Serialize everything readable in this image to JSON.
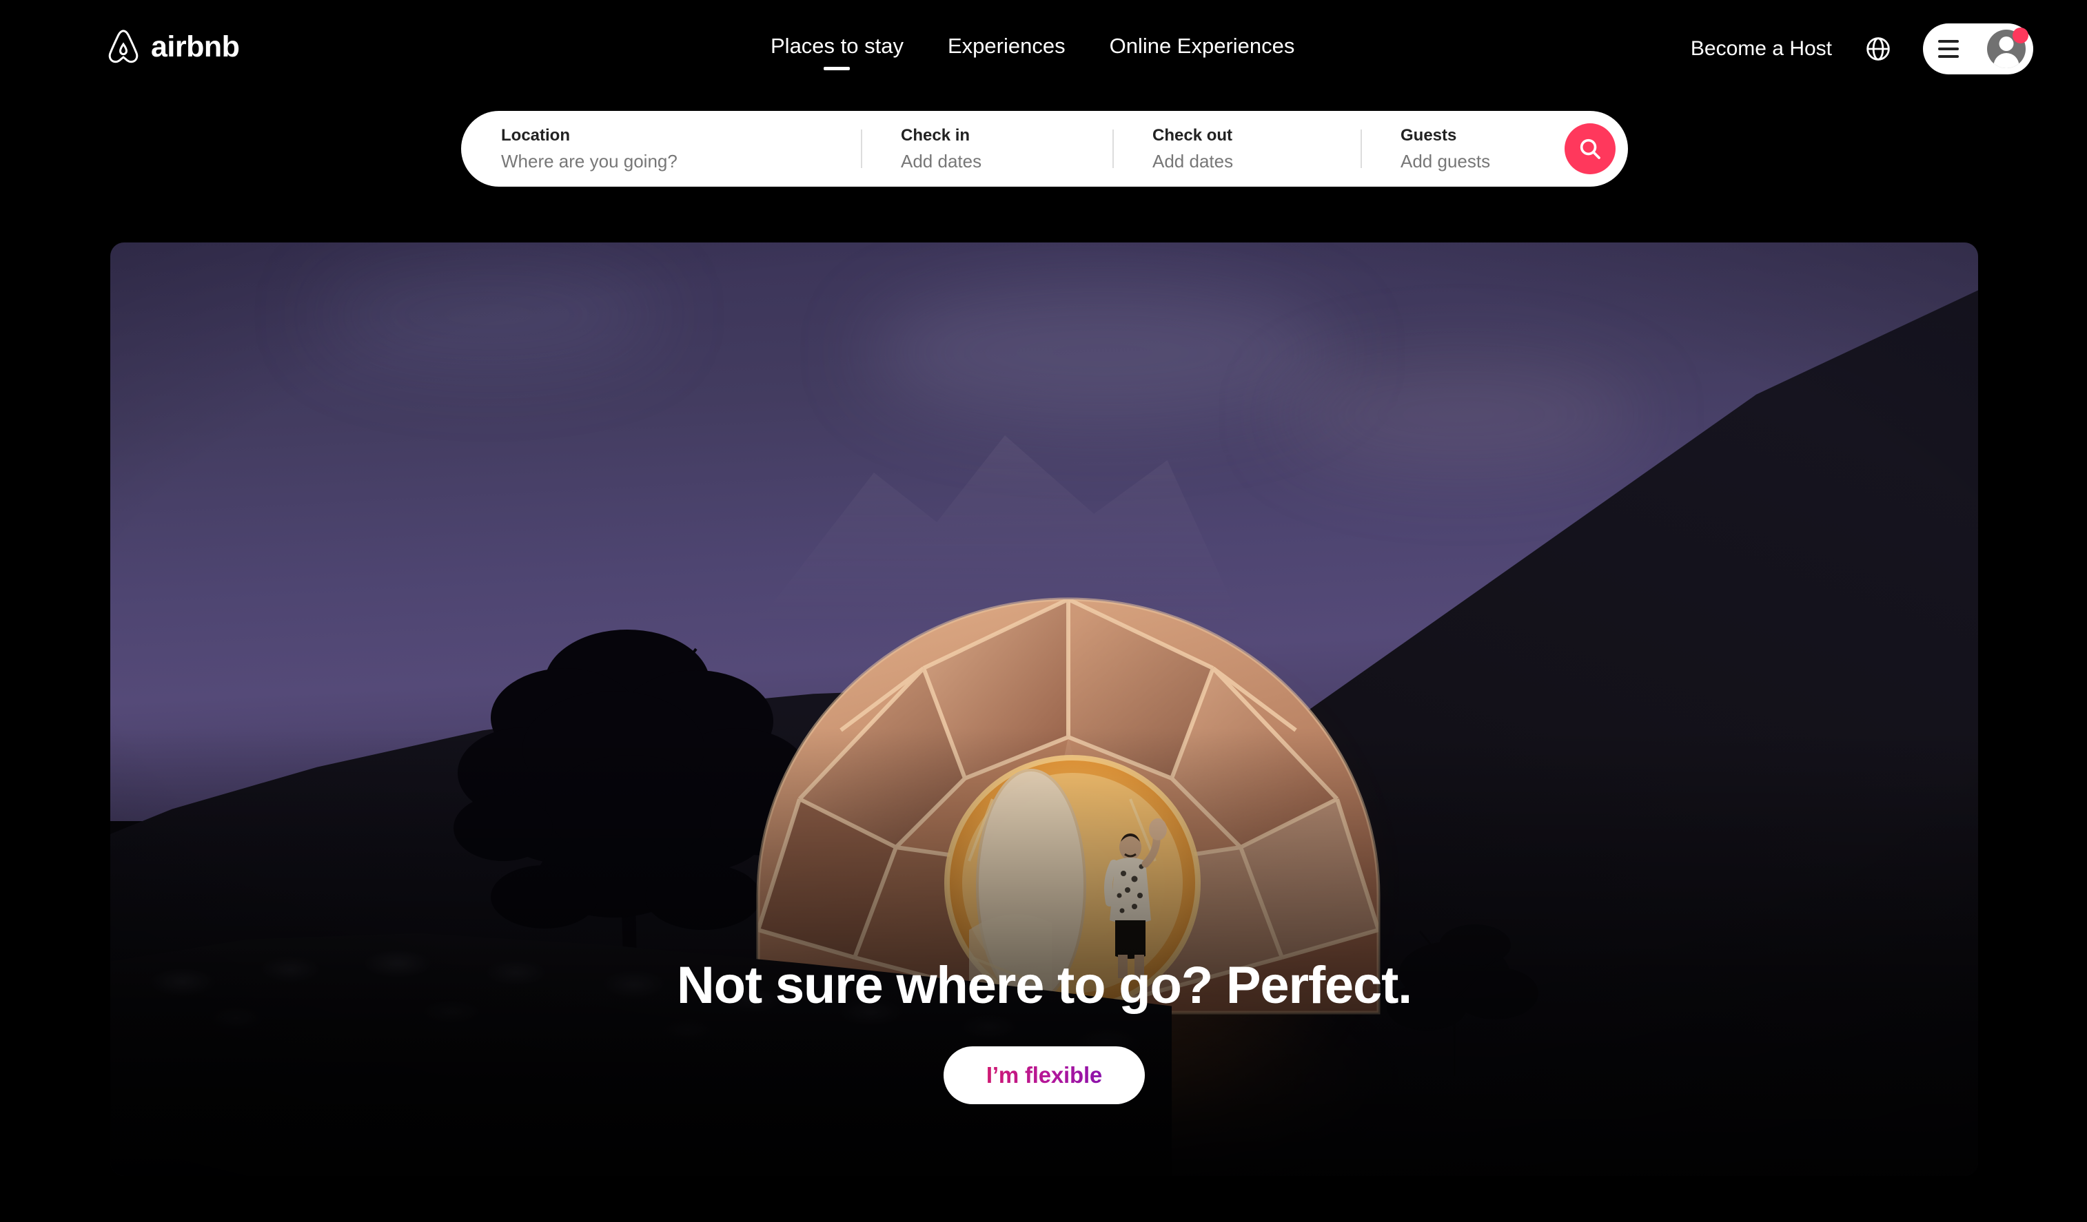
{
  "brand": {
    "name": "airbnb",
    "logo_icon": "airbnb-belo-icon",
    "accent_color": "#FF385C",
    "gradient_start": "#D01A72",
    "gradient_end": "#8B13AB"
  },
  "header": {
    "nav": [
      {
        "label": "Places to stay",
        "active": true
      },
      {
        "label": "Experiences",
        "active": false
      },
      {
        "label": "Online Experiences",
        "active": false
      }
    ],
    "become_host": "Become a Host",
    "globe_icon": "globe-icon",
    "menu_icon": "hamburger-icon",
    "avatar_icon": "user-avatar-icon",
    "notification_badge": true
  },
  "search": {
    "segments": [
      {
        "label": "Location",
        "value": "",
        "placeholder": "Where are you going?"
      },
      {
        "label": "Check in",
        "value": "",
        "placeholder": "Add dates"
      },
      {
        "label": "Check out",
        "value": "",
        "placeholder": "Add dates"
      },
      {
        "label": "Guests",
        "value": "",
        "placeholder": "Add guests"
      }
    ],
    "search_icon": "search-icon"
  },
  "hero": {
    "title": "Not sure where to go? Perfect.",
    "cta_label": "I’m flexible",
    "image_alt": "geodesic-glamping-dome-at-dusk"
  }
}
